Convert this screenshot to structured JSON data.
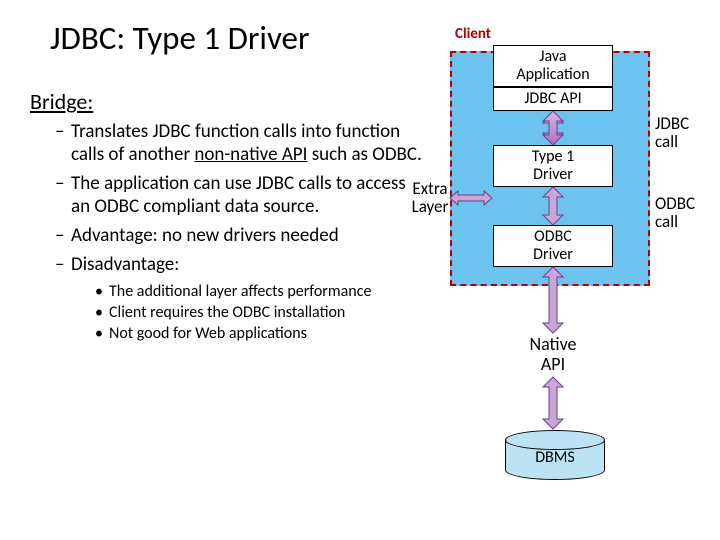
{
  "title": "JDBC:  Type 1 Driver",
  "subtitle": "Bridge:",
  "bullets": {
    "b1_prefix": "Translates JDBC function calls into function calls of another ",
    "b1_ul": "non-native API",
    "b1_suffix": " such as ODBC.",
    "b2": "The application can use JDBC calls to access an ODBC compliant data source.",
    "b3": "Advantage:  no new drivers needed",
    "b4": "Disadvantage:"
  },
  "sub": {
    "s1": "The additional layer affects performance",
    "s2": "Client requires the ODBC installation",
    "s3": "Not good for Web applications"
  },
  "diagram": {
    "client": "Client",
    "java_app_l1": "Java",
    "java_app_l2": "Application",
    "jdbc_api": "JDBC API",
    "type1_l1": "Type 1",
    "type1_l2": "Driver",
    "odbc_l1": "ODBC",
    "odbc_l2": "Driver",
    "native_l1": "Native",
    "native_l2": "API",
    "dbms": "DBMS",
    "extra_l1": "Extra",
    "extra_l2": "Layer",
    "jdbc_call_l1": "JDBC",
    "jdbc_call_l2": "call",
    "odbc_call_l1": "ODBC",
    "odbc_call_l2": "call"
  }
}
